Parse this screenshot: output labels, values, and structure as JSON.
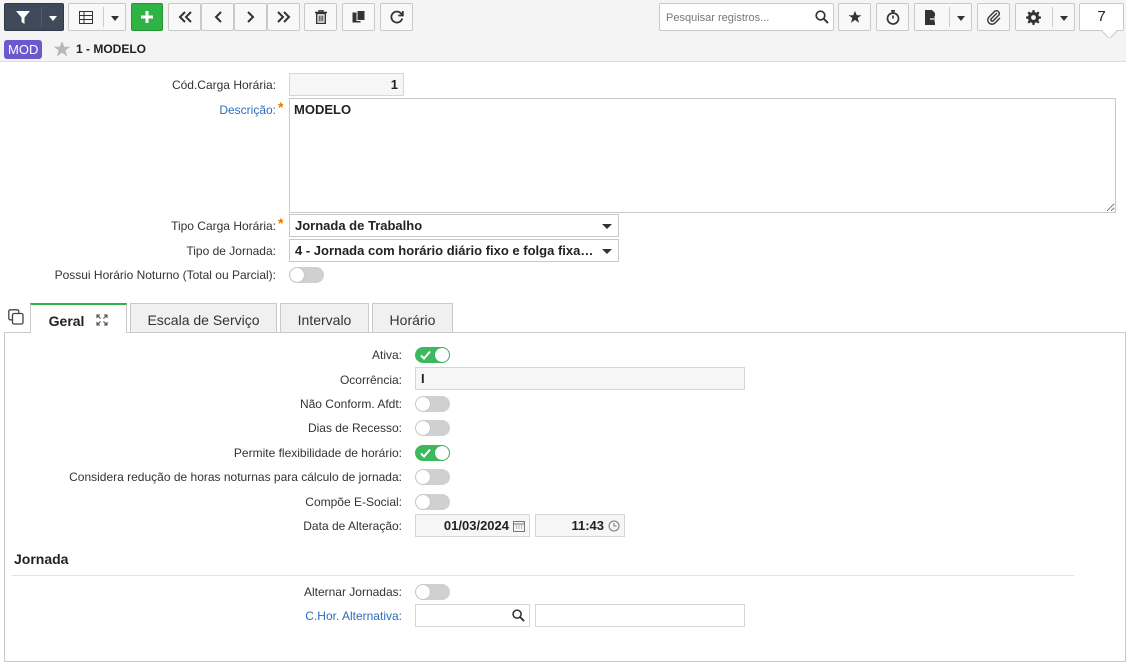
{
  "toolbar": {
    "search_placeholder": "Pesquisar registros...",
    "record_count": "7",
    "icons": [
      "filter-icon",
      "grid-icon",
      "add-icon",
      "first-icon",
      "prev-icon",
      "next-icon",
      "last-icon",
      "delete-icon",
      "copy-icon",
      "refresh-icon",
      "search-icon",
      "star-icon",
      "timer-icon",
      "export-icon",
      "attach-icon",
      "gear-icon"
    ],
    "colors": {
      "primary_dark": "#3e4a59",
      "add_green": "#2fb344",
      "badge_purple": "#6a5acd",
      "link_blue": "#2a6ebb",
      "required_orange": "#e07b00",
      "toggle_on": "#3cb95c"
    }
  },
  "header": {
    "badge": "MOD",
    "title": "1 - MODELO"
  },
  "form": {
    "cod_label": "Cód.Carga Horária:",
    "cod_value": "1",
    "descricao_label": "Descrição:",
    "descricao_value": "MODELO",
    "tipo_carga_label": "Tipo Carga Horária:",
    "tipo_carga_value": "Jornada de Trabalho",
    "tipo_jornada_label": "Tipo de Jornada:",
    "tipo_jornada_value": "4 - Jornada com horário diário fixo e folga fixa (…",
    "noturno_label": "Possui Horário Noturno (Total ou Parcial):",
    "noturno_on": false
  },
  "tabs": [
    {
      "label": "Geral",
      "active": true
    },
    {
      "label": "Escala de Serviço",
      "active": false
    },
    {
      "label": "Intervalo",
      "active": false
    },
    {
      "label": "Horário",
      "active": false
    }
  ],
  "geral": {
    "ativa_label": "Ativa:",
    "ativa_on": true,
    "ocorrencia_label": "Ocorrência:",
    "ocorrencia_value": "I",
    "nao_conform_label": "Não Conform. Afdt:",
    "nao_conform_on": false,
    "dias_recesso_label": "Dias de Recesso:",
    "dias_recesso_on": false,
    "flex_label": "Permite flexibilidade de horário:",
    "flex_on": true,
    "reducao_label": "Considera redução de horas noturnas para cálculo de jornada:",
    "reducao_on": false,
    "esocial_label": "Compõe E-Social:",
    "esocial_on": false,
    "data_alt_label": "Data de Alteração:",
    "data_alt_date": "01/03/2024",
    "data_alt_time": "11:43"
  },
  "jornada": {
    "title": "Jornada",
    "alternar_label": "Alternar Jornadas:",
    "alternar_on": false,
    "chor_label": "C.Hor. Alternativa:",
    "chor_code": "",
    "chor_desc": ""
  }
}
